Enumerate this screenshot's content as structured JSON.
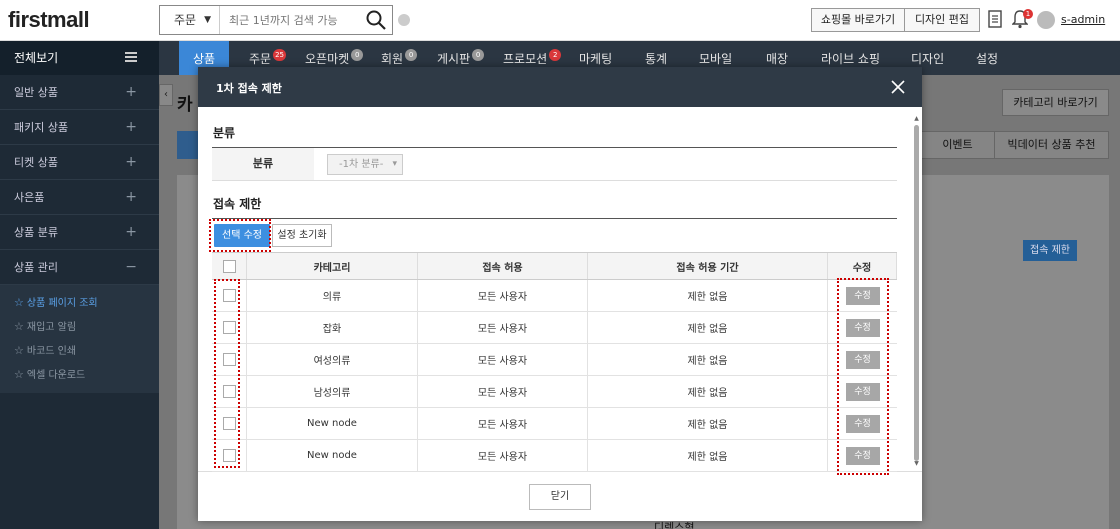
{
  "header": {
    "logo": "firstmall",
    "search_scope": "주문",
    "search_placeholder": "최근 1년까지 검색 가능",
    "btn_shop": "쇼핑몰 바로가기",
    "btn_design": "디자인 편집",
    "bell_count": "1",
    "user": "s-admin"
  },
  "sidebar": {
    "top": "전체보기",
    "items": [
      {
        "label": "일반 상품",
        "sign": "+"
      },
      {
        "label": "패키지 상품",
        "sign": "+"
      },
      {
        "label": "티켓 상품",
        "sign": "+"
      },
      {
        "label": "사은품",
        "sign": "+"
      },
      {
        "label": "상품 분류",
        "sign": "+"
      },
      {
        "label": "상품 관리",
        "sign": "−"
      }
    ],
    "sub_items": [
      "상품 페이지 조회",
      "재입고 알림",
      "바코드 인쇄",
      "엑셀 다운로드"
    ]
  },
  "topnav": [
    {
      "label": "상품",
      "badge": ""
    },
    {
      "label": "주문",
      "badge": "25"
    },
    {
      "label": "오픈마켓",
      "badge": "0"
    },
    {
      "label": "회원",
      "badge": "0"
    },
    {
      "label": "게시판",
      "badge": "0"
    },
    {
      "label": "프로모션",
      "badge": "2"
    },
    {
      "label": "마케팅",
      "badge": ""
    },
    {
      "label": "통계",
      "badge": ""
    },
    {
      "label": "모바일",
      "badge": ""
    },
    {
      "label": "매장",
      "badge": ""
    },
    {
      "label": "라이브 쇼핑",
      "badge": ""
    },
    {
      "label": "디자인",
      "badge": ""
    },
    {
      "label": "설정",
      "badge": ""
    }
  ],
  "background": {
    "title": "카",
    "btn_category_view": "카테고리 바로가기",
    "tab_event": "이벤트",
    "tab_bigdata": "빅데이터 상품 추천",
    "btn_access": "접속 제한",
    "footer_text": "디렉스형"
  },
  "modal": {
    "title": "1차 접속 제한",
    "section_classification": "분류",
    "classification_label": "분류",
    "classification_select": "-1차 분류-",
    "section_access": "접속 제한",
    "btn_select_edit": "선택 수정",
    "btn_reset": "설정 초기화",
    "columns": [
      "카테고리",
      "접속 허용",
      "접속 허용 기간",
      "수정"
    ],
    "rows": [
      {
        "category": "의류",
        "permission": "모든 사용자",
        "period": "제한 없음",
        "edit": "수정"
      },
      {
        "category": "잡화",
        "permission": "모든 사용자",
        "period": "제한 없음",
        "edit": "수정"
      },
      {
        "category": "여성의류",
        "permission": "모든 사용자",
        "period": "제한 없음",
        "edit": "수정"
      },
      {
        "category": "남성의류",
        "permission": "모든 사용자",
        "period": "제한 없음",
        "edit": "수정"
      },
      {
        "category": "New node",
        "permission": "모든 사용자",
        "period": "제한 없음",
        "edit": "수정"
      },
      {
        "category": "New node",
        "permission": "모든 사용자",
        "period": "제한 없음",
        "edit": "수정"
      }
    ],
    "btn_close": "닫기"
  }
}
